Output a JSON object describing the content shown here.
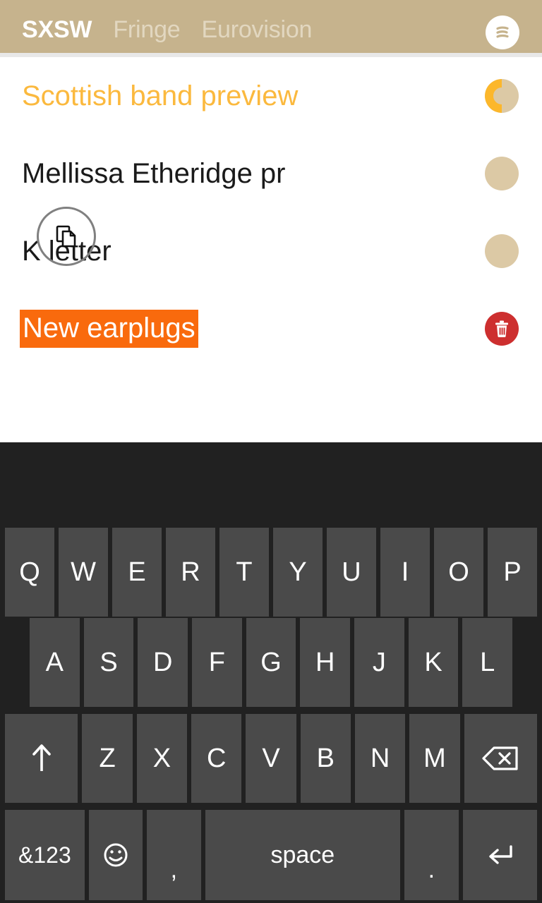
{
  "header": {
    "tabs": [
      {
        "label": "SXSW",
        "active": true
      },
      {
        "label": "Fringe",
        "active": false
      },
      {
        "label": "Eurovision",
        "active": false
      }
    ],
    "menu_icon": "sort-lines-icon",
    "bg_color": "#c6b38d",
    "active_tab_color": "#ffffff",
    "inactive_tab_color": "#e2d7c0"
  },
  "list": {
    "items": [
      {
        "text": "Scottish band preview",
        "text_color": "#fbb93e",
        "state": "amber",
        "badge": "half-circle-indicator",
        "badge_fill_color": "#fcb72b",
        "badge_bg_color": "#dcc9a5"
      },
      {
        "text": "Mellissa Etheridge pr",
        "text_color": "#1a1a1a",
        "state": "normal",
        "badge": "circle-indicator",
        "badge_bg_color": "#dcc9a5"
      },
      {
        "text": "K letter",
        "text_color": "#1a1a1a",
        "state": "normal",
        "badge": "circle-indicator",
        "badge_bg_color": "#dcc9a5",
        "overlay_icon": "copy-icon"
      },
      {
        "text": "New earplugs",
        "text_color": "#ffffff",
        "state": "selected",
        "selection_color": "#f96a0d",
        "badge": "delete-button",
        "badge_bg_color": "#cd2f2f",
        "badge_icon": "trash-icon"
      }
    ]
  },
  "keyboard": {
    "bg_color": "#212121",
    "key_color": "#4a4a4a",
    "key_text_color": "#ffffff",
    "rows": [
      {
        "id": "row-1",
        "keys": [
          {
            "label": "Q"
          },
          {
            "label": "W"
          },
          {
            "label": "E"
          },
          {
            "label": "R"
          },
          {
            "label": "T"
          },
          {
            "label": "Y"
          },
          {
            "label": "U"
          },
          {
            "label": "I"
          },
          {
            "label": "O"
          },
          {
            "label": "P"
          }
        ]
      },
      {
        "id": "row-2",
        "keys": [
          {
            "label": "A"
          },
          {
            "label": "S"
          },
          {
            "label": "D"
          },
          {
            "label": "F"
          },
          {
            "label": "G"
          },
          {
            "label": "H"
          },
          {
            "label": "J"
          },
          {
            "label": "K"
          },
          {
            "label": "L"
          }
        ]
      },
      {
        "id": "row-3",
        "keys": [
          {
            "label": "",
            "icon": "shift-arrow-up-icon",
            "name": "shift-key"
          },
          {
            "label": "Z"
          },
          {
            "label": "X"
          },
          {
            "label": "C"
          },
          {
            "label": "V"
          },
          {
            "label": "B"
          },
          {
            "label": "N"
          },
          {
            "label": "M"
          },
          {
            "label": "",
            "icon": "backspace-icon",
            "name": "backspace-key"
          }
        ]
      },
      {
        "id": "row-4",
        "keys": [
          {
            "label": "&123",
            "name": "symbols-key"
          },
          {
            "label": "",
            "icon": "emoji-smiley-icon",
            "name": "emoji-key"
          },
          {
            "label": ",",
            "name": "comma-key"
          },
          {
            "label": "space",
            "name": "space-key"
          },
          {
            "label": ".",
            "name": "period-key"
          },
          {
            "label": "",
            "icon": "enter-return-icon",
            "name": "enter-key"
          }
        ]
      }
    ]
  }
}
